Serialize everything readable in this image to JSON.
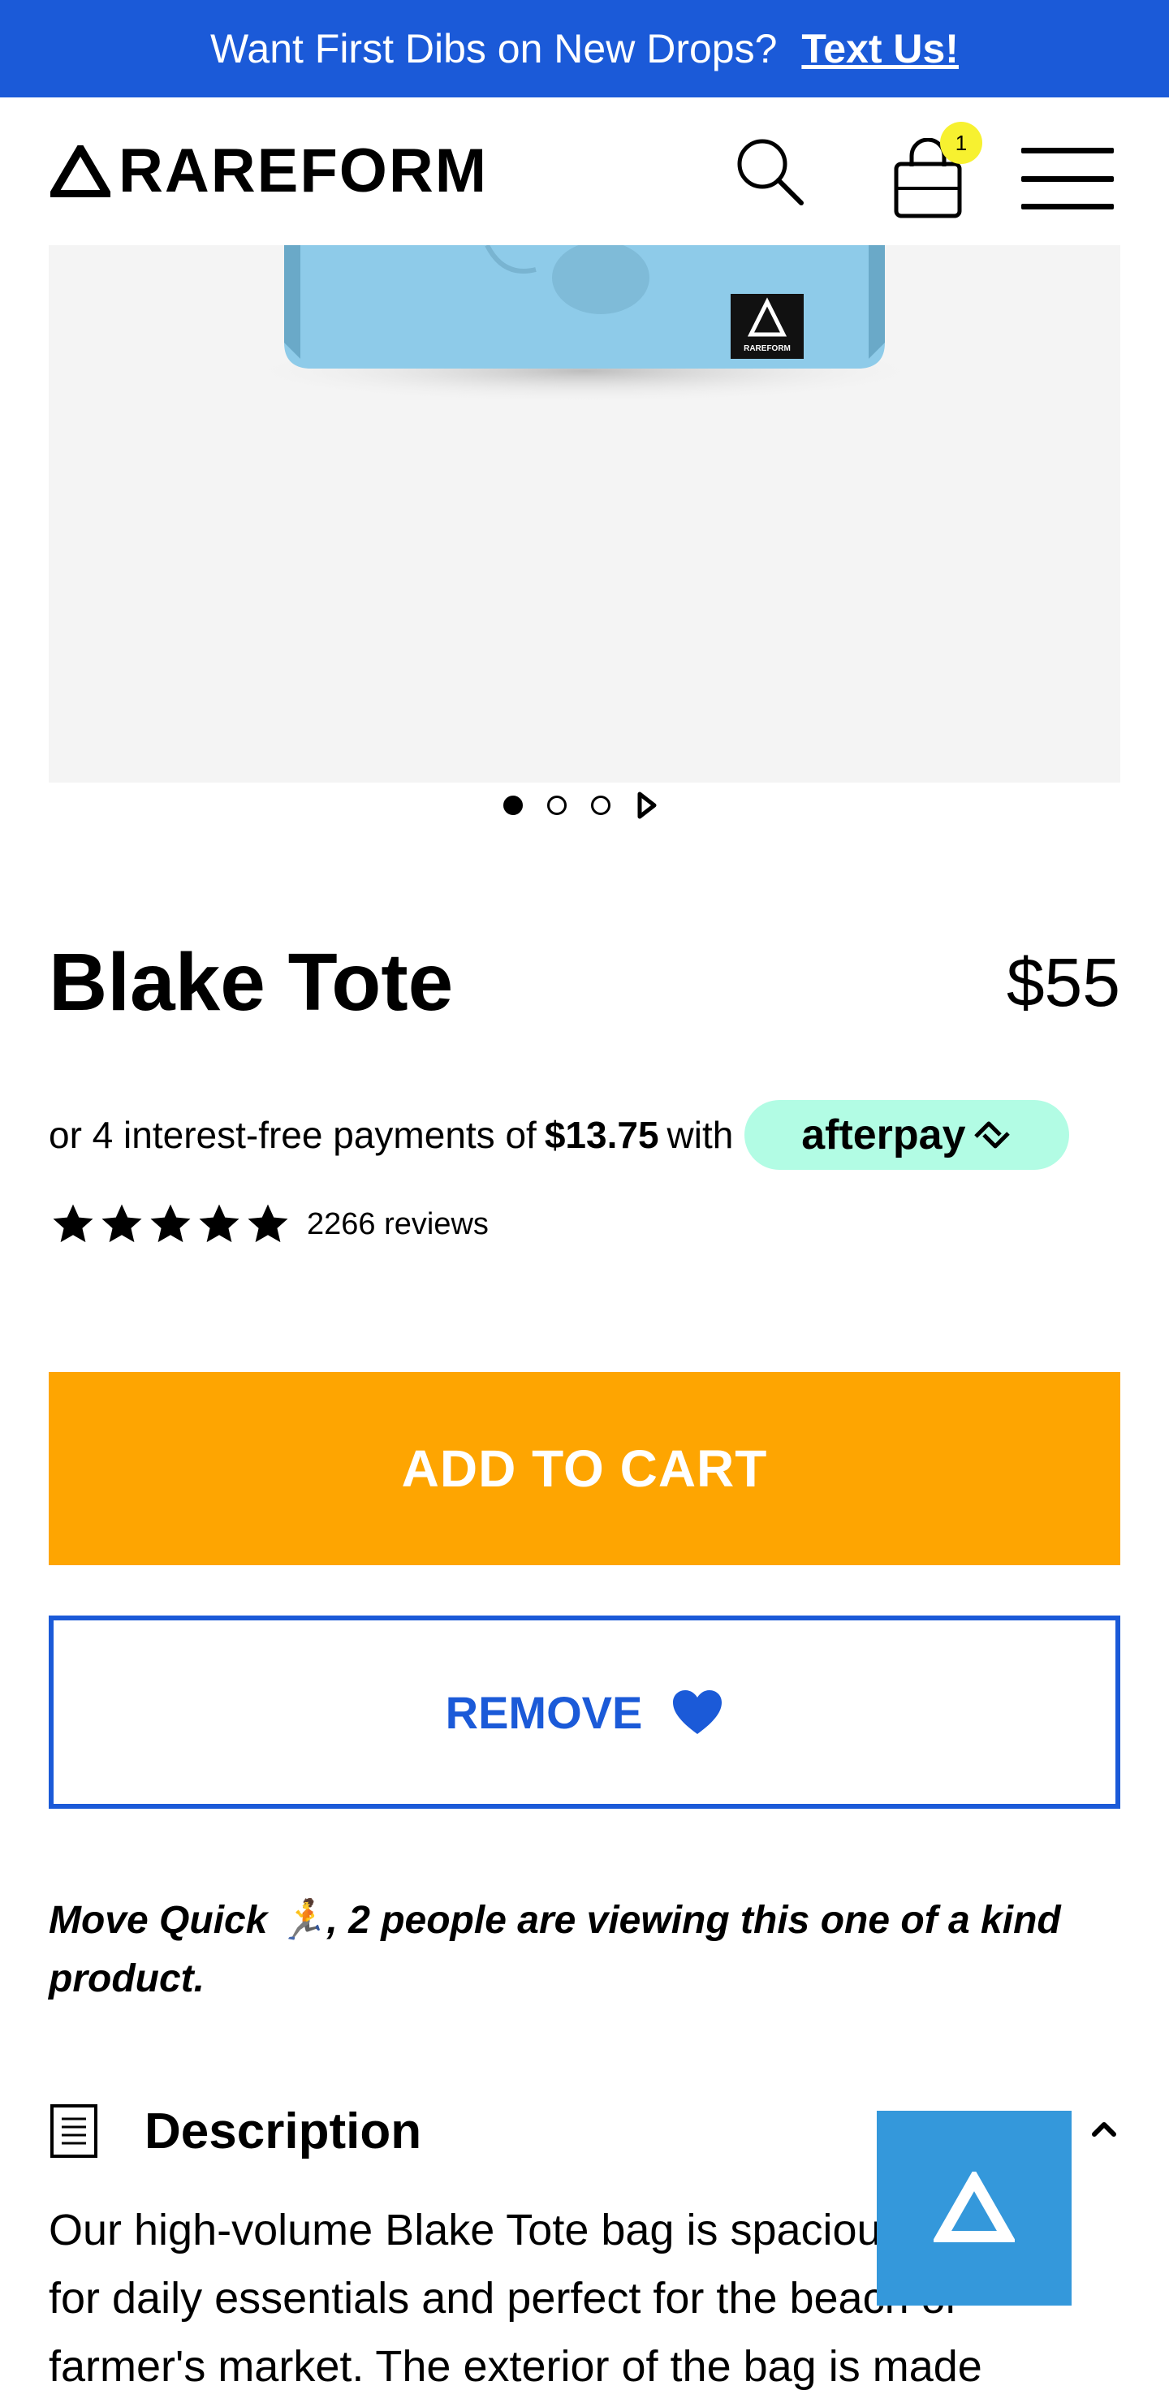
{
  "announcement": {
    "text": "Want First Dibs on New Drops?",
    "cta": "Text Us!"
  },
  "header": {
    "brand": "RAREFORM",
    "cart_count": "1"
  },
  "gallery": {
    "product_tag_text": "RAREFORM",
    "slides": 3,
    "active_slide": 1
  },
  "product": {
    "title": "Blake Tote",
    "price": "$55"
  },
  "afterpay": {
    "prefix": "or 4 interest-free payments of",
    "amount": "$13.75",
    "suffix": "with",
    "brand": "afterpay"
  },
  "reviews": {
    "rating": 5,
    "count_text": "2266 reviews"
  },
  "actions": {
    "add_to_cart": "ADD TO CART",
    "remove": "REMOVE"
  },
  "urgency": {
    "text": "Move Quick 🏃, 2 people are viewing this one of a kind product."
  },
  "description": {
    "title": "Description",
    "body": "Our high-volume Blake Tote bag is spacious enough for daily essentials and perfect for the beach or farmer's market. The exterior of the bag is made"
  },
  "colors": {
    "announcement_bg": "#1b5ad8",
    "add_to_cart_bg": "#fea501",
    "remove_border": "#1b5ad8",
    "afterpay_bg": "#b2fce4",
    "chat_widget_bg": "#3498db",
    "product_bag": "#8ecbe9"
  },
  "icons": [
    "logo-mark-icon",
    "search-icon",
    "shopping-bag-icon",
    "hamburger-menu-icon",
    "carousel-next-icon",
    "star-icon",
    "heart-icon",
    "document-icon",
    "chevron-up-icon",
    "rareform-logo-icon"
  ]
}
